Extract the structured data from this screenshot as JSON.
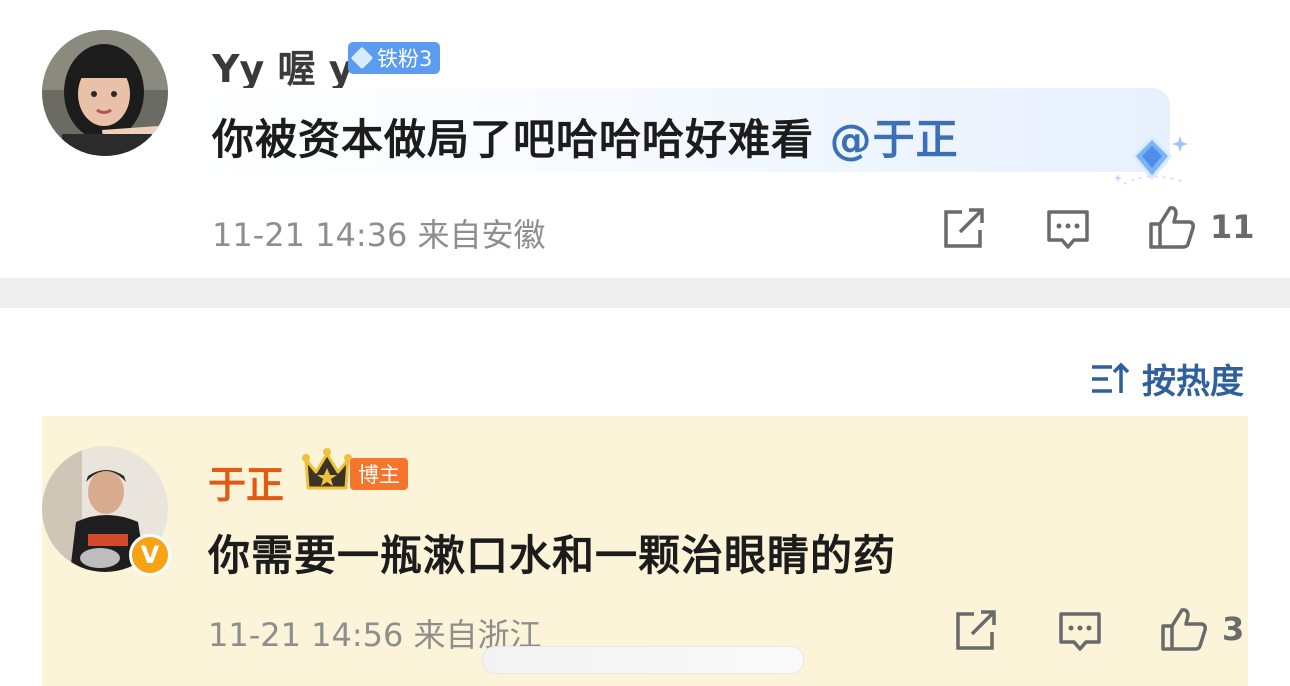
{
  "comments": [
    {
      "username": "Yy 喔 y",
      "badge": "铁粉3",
      "text": "你被资本做局了吧哈哈哈好难看 ",
      "mention": "@于正",
      "time": "11-21 14:36",
      "location": "来自安徽",
      "likes": "11"
    },
    {
      "username": "于正",
      "badge": "博主",
      "text": "你需要一瓶漱口水和一颗治眼睛的药",
      "time": "11-21 14:56",
      "location": "来自浙江",
      "likes": "3"
    }
  ],
  "sort": {
    "label": "按热度"
  },
  "colors": {
    "accent": "#2f5f9c",
    "host_name": "#e25a12",
    "host_bg": "#fbf4d9",
    "fan_badge": "#5b9cf0"
  },
  "icons": [
    "share-icon",
    "comment-icon",
    "like-icon",
    "sort-icon",
    "crown-icon",
    "verified-icon",
    "diamond-icon"
  ]
}
